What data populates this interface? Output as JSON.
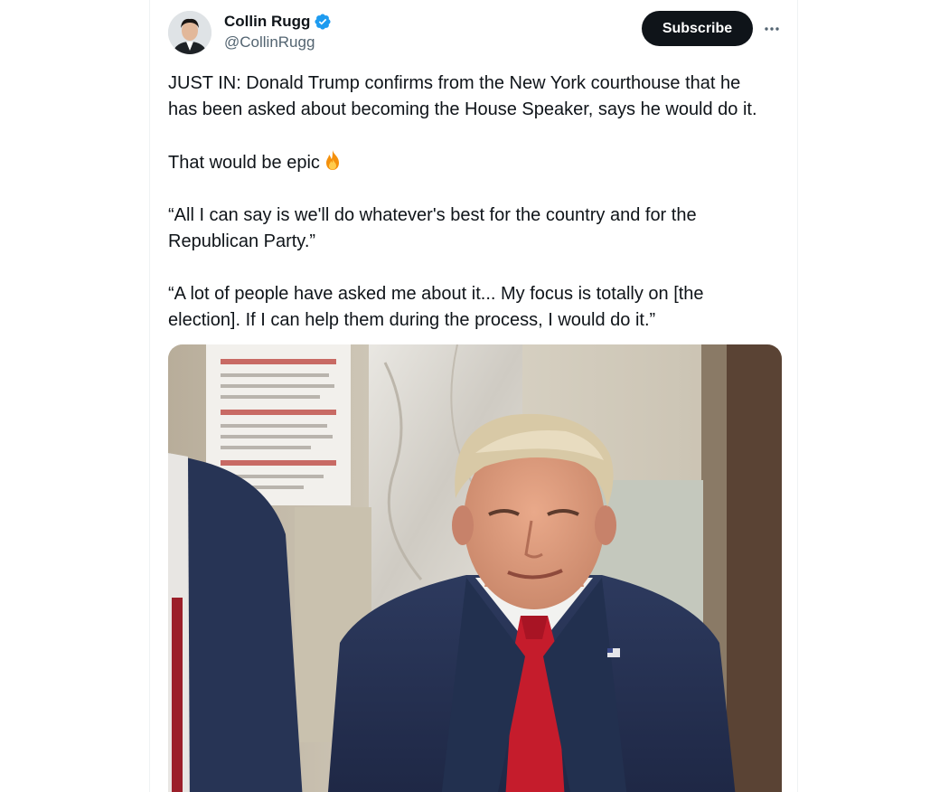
{
  "author": {
    "display_name": "Collin Rugg",
    "handle": "@CollinRugg",
    "verified_icon": "verified-badge-icon"
  },
  "actions": {
    "subscribe_label": "Subscribe",
    "more_icon": "more-options-icon"
  },
  "tweet": {
    "paragraphs": [
      {
        "line1": "JUST IN: Donald Trump confirms from the New York courthouse that he",
        "line2": "has been asked about becoming the House Speaker, says he would do it."
      },
      {
        "line1": "That would be epic",
        "emoji_icon": "fire-icon"
      },
      {
        "line1": "“All I can say is we'll do whatever's best for the country and for the",
        "line2": "Republican Party.”"
      },
      {
        "line1": "“A lot of people have asked me about it... My focus is totally on [the",
        "line2": "election]. If I can help them during the process, I would do it.”"
      }
    ]
  },
  "media": {
    "kind": "video-thumbnail"
  },
  "colors": {
    "text_primary": "#0f1419",
    "text_secondary": "#536471",
    "verified_blue": "#1d9bf0",
    "button_dark": "#0f1419",
    "border": "#eff3f4"
  }
}
